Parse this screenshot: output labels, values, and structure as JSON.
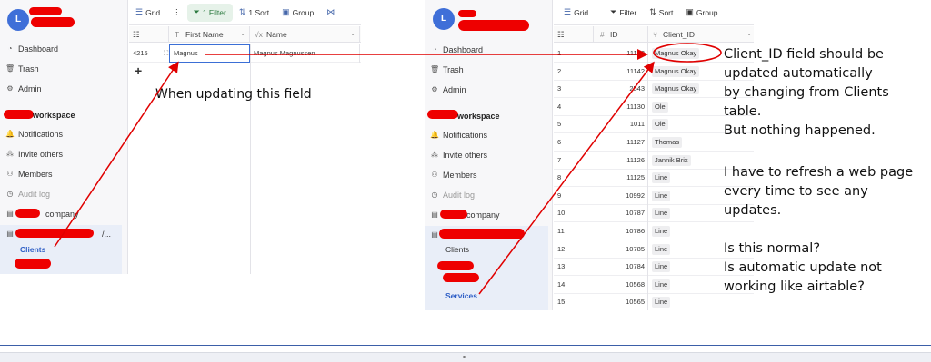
{
  "colors": {
    "annotation": "#e00000",
    "accent": "#2f5fc6",
    "avatar": "#3f6fd8"
  },
  "left_panel": {
    "avatar_letter": "L",
    "nav": [
      {
        "icon": "dashboard-icon",
        "label": "Dashboard"
      },
      {
        "icon": "trash-icon",
        "label": "Trash"
      },
      {
        "icon": "gear-icon",
        "label": "Admin"
      }
    ],
    "workspace_label": "workspace",
    "workspace_nav": [
      {
        "icon": "bell-icon",
        "label": "Notifications"
      },
      {
        "icon": "invite-icon",
        "label": "Invite others"
      },
      {
        "icon": "members-icon",
        "label": "Members"
      },
      {
        "icon": "audit-icon",
        "label": "Audit log"
      }
    ],
    "base_company": "company",
    "base_other_suffix": "/...",
    "tables": [
      "Clients"
    ],
    "toolbar": {
      "grid": "Grid",
      "filter": "1 Filter",
      "sort": "1 Sort",
      "group": "Group"
    },
    "columns": [
      "First Name",
      "Name"
    ],
    "row": {
      "id": "4215",
      "first_name": "Magnus",
      "name": "Magnus Magnussen"
    }
  },
  "right_panel": {
    "avatar_letter": "L",
    "nav": [
      {
        "icon": "dashboard-icon",
        "label": "Dashboard"
      },
      {
        "icon": "trash-icon",
        "label": "Trash"
      },
      {
        "icon": "gear-icon",
        "label": "Admin"
      }
    ],
    "workspace_label": "workspace",
    "workspace_nav": [
      {
        "icon": "bell-icon",
        "label": "Notifications"
      },
      {
        "icon": "invite-icon",
        "label": "Invite others"
      },
      {
        "icon": "members-icon",
        "label": "Members"
      },
      {
        "icon": "audit-icon",
        "label": "Audit log"
      }
    ],
    "base_company": "company",
    "tables": [
      "Clients",
      "Services"
    ],
    "toolbar": {
      "grid": "Grid",
      "filter": "Filter",
      "sort": "Sort",
      "group": "Group"
    },
    "columns": [
      "ID",
      "Client_ID"
    ],
    "rows": [
      {
        "n": "1",
        "id": "11143",
        "client": "Magnus Okay"
      },
      {
        "n": "2",
        "id": "11142",
        "client": "Magnus Okay"
      },
      {
        "n": "3",
        "id": "2543",
        "client": "Magnus Okay"
      },
      {
        "n": "4",
        "id": "11130",
        "client": "Ole"
      },
      {
        "n": "5",
        "id": "1011",
        "client": "Ole"
      },
      {
        "n": "6",
        "id": "11127",
        "client": "Thomas"
      },
      {
        "n": "7",
        "id": "11126",
        "client": "Jannik Brix"
      },
      {
        "n": "8",
        "id": "11125",
        "client": "Line"
      },
      {
        "n": "9",
        "id": "10992",
        "client": "Line"
      },
      {
        "n": "10",
        "id": "10787",
        "client": "Line"
      },
      {
        "n": "11",
        "id": "10786",
        "client": "Line"
      },
      {
        "n": "12",
        "id": "10785",
        "client": "Line"
      },
      {
        "n": "13",
        "id": "10784",
        "client": "Line"
      },
      {
        "n": "14",
        "id": "10568",
        "client": "Line"
      },
      {
        "n": "15",
        "id": "10565",
        "client": "Line"
      }
    ]
  },
  "annotations": {
    "left": "When updating this field",
    "right_lines": [
      "Client_ID field should be",
      "updated automatically",
      "by changing from Clients",
      "table.",
      "But nothing happened.",
      "",
      "I have to refresh a web page",
      "every time to see any",
      "updates.",
      "",
      "Is this normal?",
      "Is automatic update not",
      "working like airtable?"
    ]
  }
}
